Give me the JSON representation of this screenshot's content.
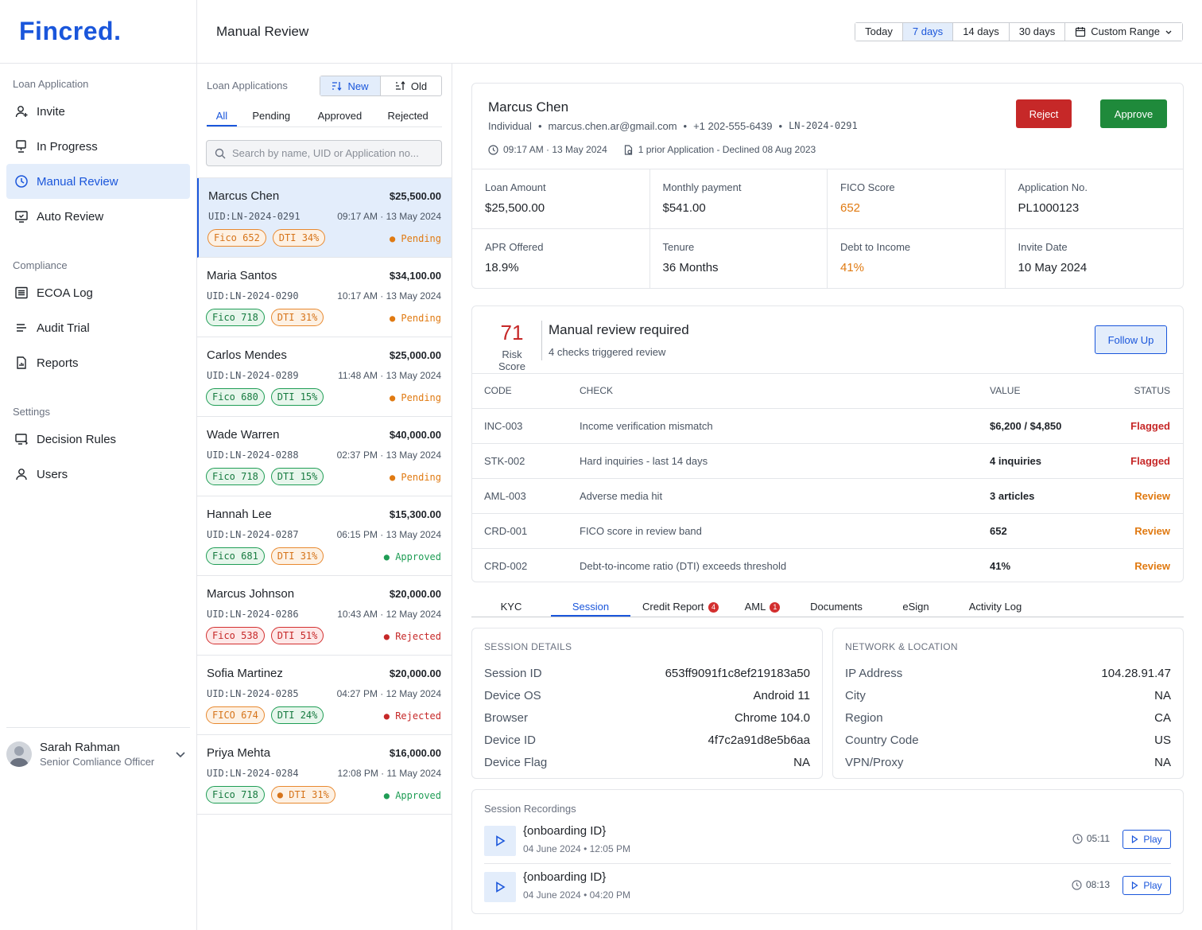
{
  "brand": {
    "logo": "Fincred."
  },
  "sidebar": {
    "sections": [
      {
        "heading": "Loan Application",
        "items": [
          {
            "label": "Invite",
            "icon": "user-plus-icon"
          },
          {
            "label": "In Progress",
            "icon": "monitor-icon"
          },
          {
            "label": "Manual Review",
            "icon": "clock-icon",
            "active": true
          },
          {
            "label": "Auto Review",
            "icon": "screen-check-icon"
          }
        ]
      },
      {
        "heading": "Compliance",
        "items": [
          {
            "label": "ECOA Log",
            "icon": "list-icon"
          },
          {
            "label": "Audit Trial",
            "icon": "lines-icon"
          },
          {
            "label": "Reports",
            "icon": "file-chart-icon"
          }
        ]
      },
      {
        "heading": "Settings",
        "items": [
          {
            "label": "Decision Rules",
            "icon": "screen-rule-icon"
          },
          {
            "label": "Users",
            "icon": "user-icon"
          }
        ]
      }
    ],
    "user": {
      "name": "Sarah Rahman",
      "role": "Senior Comliance Officer"
    }
  },
  "header": {
    "title": "Manual Review",
    "ranges": [
      "Today",
      "7 days",
      "14 days",
      "30 days",
      "Custom Range"
    ],
    "active_range": "7 days"
  },
  "list": {
    "title": "Loan Applications",
    "sort": {
      "new": "New",
      "old": "Old"
    },
    "tabs": [
      "All",
      "Pending",
      "Approved",
      "Rejected"
    ],
    "search_placeholder": "Search by name, UID or Application no...",
    "items": [
      {
        "name": "Marcus Chen",
        "amount": "$25,500.00",
        "uid": "UID:LN-2024-0291",
        "time": "09:17 AM · 13 May 2024",
        "fico": "Fico 652",
        "fico_color": "orange",
        "dti": "DTI 34%",
        "dti_color": "orange",
        "status": "● Pending",
        "status_kind": "pending"
      },
      {
        "name": "Maria Santos",
        "amount": "$34,100.00",
        "uid": "UID:LN-2024-0290",
        "time": "10:17 AM · 13 May 2024",
        "fico": "Fico 718",
        "fico_color": "green",
        "dti": "DTI 31%",
        "dti_color": "orange",
        "status": "● Pending",
        "status_kind": "pending"
      },
      {
        "name": "Carlos Mendes",
        "amount": "$25,000.00",
        "uid": "UID:LN-2024-0289",
        "time": "11:48 AM · 13 May 2024",
        "fico": "Fico 680",
        "fico_color": "green",
        "dti": "DTI 15%",
        "dti_color": "green",
        "status": "● Pending",
        "status_kind": "pending"
      },
      {
        "name": "Wade Warren",
        "amount": "$40,000.00",
        "uid": "UID:LN-2024-0288",
        "time": "02:37 PM · 13 May 2024",
        "fico": "Fico 718",
        "fico_color": "green",
        "dti": "DTI 15%",
        "dti_color": "green",
        "status": "● Pending",
        "status_kind": "pending"
      },
      {
        "name": "Hannah Lee",
        "amount": "$15,300.00",
        "uid": "UID:LN-2024-0287",
        "time": "06:15 PM · 13 May 2024",
        "fico": "Fico 681",
        "fico_color": "green",
        "dti": "DTI 31%",
        "dti_color": "orange",
        "status": "● Approved",
        "status_kind": "approved"
      },
      {
        "name": "Marcus Johnson",
        "amount": "$20,000.00",
        "uid": "UID:LN-2024-0286",
        "time": "10:43 AM · 12 May 2024",
        "fico": "Fico 538",
        "fico_color": "red",
        "dti": "DTI 51%",
        "dti_color": "red",
        "status": "● Rejected",
        "status_kind": "rejected"
      },
      {
        "name": "Sofia Martinez",
        "amount": "$20,000.00",
        "uid": "UID:LN-2024-0285",
        "time": "04:27 PM · 12 May 2024",
        "fico": "FICO 674",
        "fico_color": "orange",
        "dti": "DTI 24%",
        "dti_color": "green",
        "status": "● Rejected",
        "status_kind": "rejected"
      },
      {
        "name": "Priya Mehta",
        "amount": "$16,000.00",
        "uid": "UID:LN-2024-0284",
        "time": "12:08 PM · 11 May 2024",
        "fico": "Fico 718",
        "fico_color": "green",
        "dti": "● DTI 31%",
        "dti_color": "orange",
        "status": "● Approved",
        "status_kind": "approved"
      }
    ]
  },
  "applicant": {
    "name": "Marcus Chen",
    "type": "Individual",
    "email": "marcus.chen.ar@gmail.com",
    "phone": "+1 202-555-6439",
    "loan_id": "LN-2024-0291",
    "submitted": "09:17 AM · 13 May 2024",
    "prior": "1 prior Application - Declined 08 Aug 2023",
    "reject_label": "Reject",
    "approve_label": "Approve",
    "metrics": [
      {
        "label": "Loan Amount",
        "value": "$25,500.00"
      },
      {
        "label": "Monthly payment",
        "value": "$541.00"
      },
      {
        "label": "FICO Score",
        "value": "652",
        "highlight": true
      },
      {
        "label": "Application No.",
        "value": "PL1000123"
      },
      {
        "label": "APR Offered",
        "value": "18.9%"
      },
      {
        "label": "Tenure",
        "value": "36 Months"
      },
      {
        "label": "Debt to Income",
        "value": "41%",
        "highlight": true
      },
      {
        "label": "Invite Date",
        "value": "10 May 2024"
      }
    ]
  },
  "risk": {
    "score": "71",
    "score_label": "Risk Score",
    "title": "Manual review required",
    "subtitle": "4 checks triggered review",
    "follow_label": "Follow Up",
    "columns": [
      "CODE",
      "CHECK",
      "VALUE",
      "STATUS"
    ],
    "rows": [
      {
        "code": "INC-003",
        "check": "Income verification mismatch",
        "value": "$6,200 / $4,850",
        "status": "Flagged"
      },
      {
        "code": "STK-002",
        "check": "Hard inquiries - last 14 days",
        "value": "4 inquiries",
        "status": "Flagged"
      },
      {
        "code": "AML-003",
        "check": "Adverse media hit",
        "value": "3 articles",
        "status": "Review"
      },
      {
        "code": "CRD-001",
        "check": "FICO score in review band",
        "value": "652",
        "status": "Review"
      },
      {
        "code": "CRD-002",
        "check": "Debt-to-income ratio (DTI) exceeds threshold",
        "value": "41%",
        "status": "Review"
      }
    ]
  },
  "detail_tabs": [
    {
      "label": "KYC"
    },
    {
      "label": "Session",
      "active": true
    },
    {
      "label": "Credit Report",
      "badge": "4"
    },
    {
      "label": "AML",
      "badge": "1"
    },
    {
      "label": "Documents"
    },
    {
      "label": "eSign"
    },
    {
      "label": "Activity Log"
    }
  ],
  "session": {
    "title": "SESSION DETAILS",
    "rows": [
      {
        "label": "Session ID",
        "value": "653ff9091f1c8ef219183a50"
      },
      {
        "label": "Device OS",
        "value": "Android 11"
      },
      {
        "label": "Browser",
        "value": "Chrome 104.0"
      },
      {
        "label": "Device ID",
        "value": "4f7c2a91d8e5b6aa"
      },
      {
        "label": "Device Flag",
        "value": "NA"
      }
    ]
  },
  "network": {
    "title": "NETWORK & LOCATION",
    "rows": [
      {
        "label": "IP Address",
        "value": "104.28.91.47"
      },
      {
        "label": "City",
        "value": "NA"
      },
      {
        "label": "Region",
        "value": "CA"
      },
      {
        "label": "Country Code",
        "value": "US"
      },
      {
        "label": "VPN/Proxy",
        "value": "NA"
      }
    ]
  },
  "recordings": {
    "title": "Session Recordings",
    "items": [
      {
        "name": "{onboarding ID}",
        "date": "04 June 2024 • 12:05 PM",
        "duration": "05:11",
        "play": "Play"
      },
      {
        "name": "{onboarding ID}",
        "date": "04 June 2024 • 04:20 PM",
        "duration": "08:13",
        "play": "Play"
      }
    ]
  },
  "colors": {
    "brand": "#1a56db",
    "reject": "#c62828",
    "approve": "#1f8a3b",
    "warning": "#e07a12",
    "active_bg": "#e3edfb"
  }
}
